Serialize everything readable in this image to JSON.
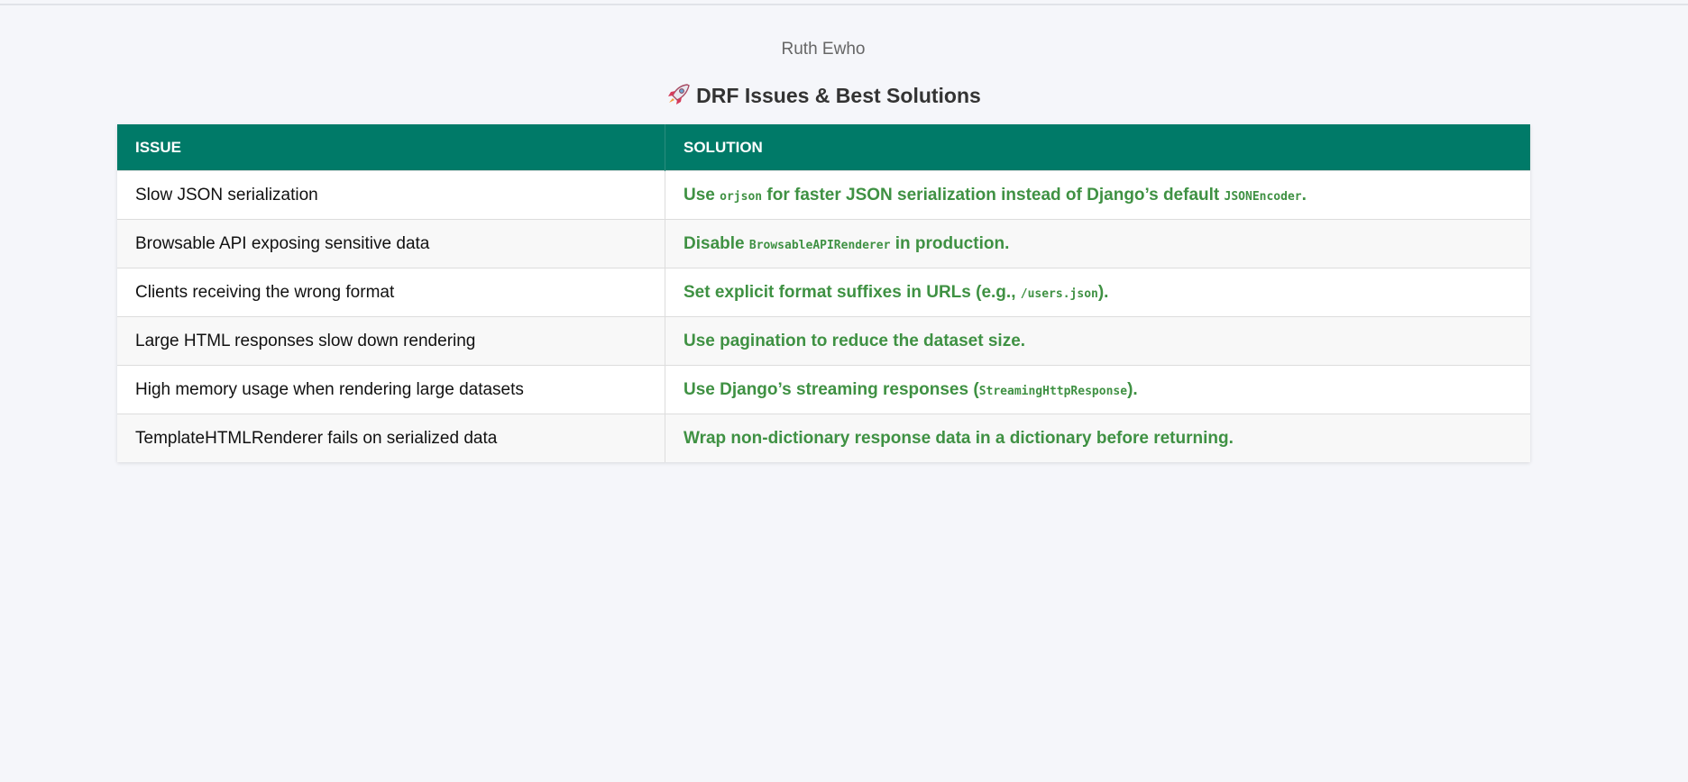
{
  "page": {
    "author": "Ruth Ewho",
    "title": "DRF Issues & Best Solutions",
    "title_icon": "rocket-icon"
  },
  "table": {
    "headers": {
      "issue": "ISSUE",
      "solution": "SOLUTION"
    },
    "rows": [
      {
        "issue": "Slow JSON serialization",
        "solution": [
          {
            "text": "Use ",
            "code": false
          },
          {
            "text": "orjson",
            "code": true
          },
          {
            "text": " for faster JSON serialization instead of Django’s default ",
            "code": false
          },
          {
            "text": "JSONEncoder",
            "code": true
          },
          {
            "text": ".",
            "code": false
          }
        ]
      },
      {
        "issue": "Browsable API exposing sensitive data",
        "solution": [
          {
            "text": "Disable ",
            "code": false
          },
          {
            "text": "BrowsableAPIRenderer",
            "code": true
          },
          {
            "text": " in production.",
            "code": false
          }
        ]
      },
      {
        "issue": "Clients receiving the wrong format",
        "solution": [
          {
            "text": "Set explicit format suffixes in URLs (e.g., ",
            "code": false
          },
          {
            "text": "/users.json",
            "code": true
          },
          {
            "text": ").",
            "code": false
          }
        ]
      },
      {
        "issue": "Large HTML responses slow down rendering",
        "solution": [
          {
            "text": "Use pagination to reduce the dataset size.",
            "code": false
          }
        ]
      },
      {
        "issue": "High memory usage when rendering large datasets",
        "solution": [
          {
            "text": "Use Django’s streaming responses (",
            "code": false
          },
          {
            "text": "StreamingHttpResponse",
            "code": true
          },
          {
            "text": ").",
            "code": false
          }
        ]
      },
      {
        "issue": "TemplateHTMLRenderer fails on serialized data",
        "solution": [
          {
            "text": "Wrap non-dictionary response data in a dictionary before returning.",
            "code": false
          }
        ]
      }
    ]
  },
  "colors": {
    "page_background": "#f5f6fa",
    "header_background": "#007a68",
    "header_text": "#ffffff",
    "solution_text": "#3f9143",
    "issue_text": "#111111",
    "author_text": "#666666",
    "title_text": "#333333"
  }
}
